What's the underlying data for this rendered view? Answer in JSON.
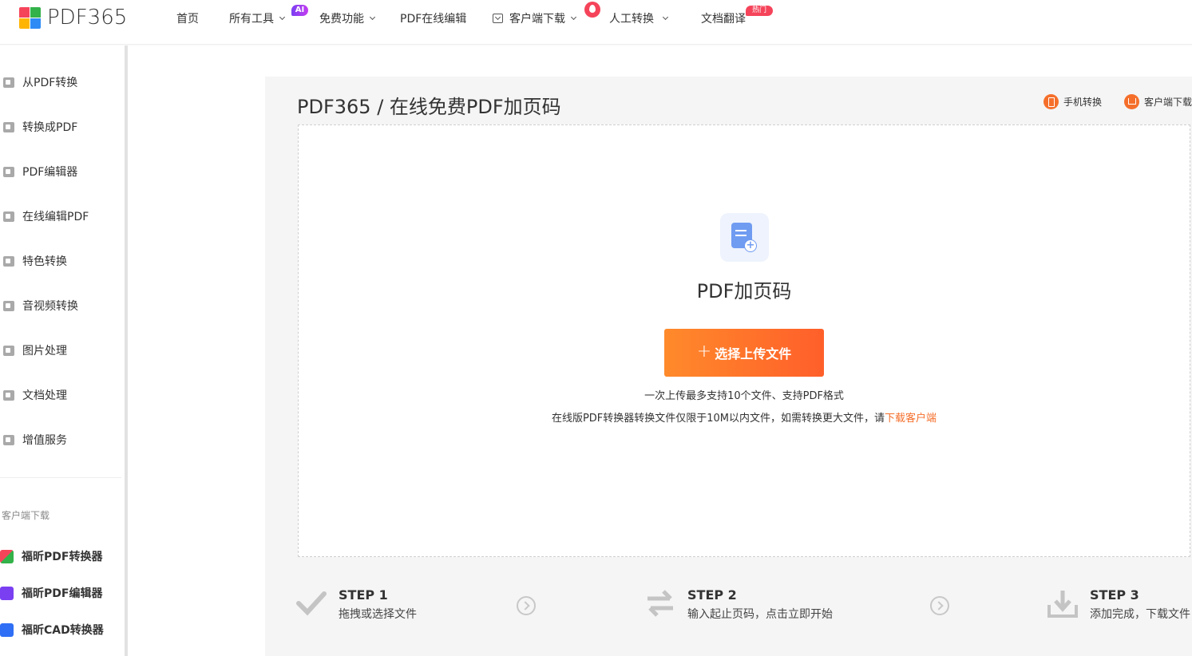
{
  "brand": {
    "name": "PDF365",
    "logo_colors": [
      "#f5445a",
      "#33b249",
      "#ffb400",
      "#2e8bf5"
    ]
  },
  "nav": {
    "home": "首页",
    "all_tools": "所有工具",
    "ai_badge": "AI",
    "free_features": "免费功能",
    "pdf_online_edit": "PDF在线编辑",
    "client_download": "客户端下载",
    "manual_convert": "人工转换",
    "doc_translate": "文档翻译",
    "hot_badge": "热门"
  },
  "sidebar": {
    "items": [
      {
        "label": "从PDF转换",
        "icon": "pdf-convert-from-icon"
      },
      {
        "label": "转换成PDF",
        "icon": "convert-to-pdf-icon"
      },
      {
        "label": "PDF编辑器",
        "icon": "pdf-editor-icon"
      },
      {
        "label": "在线编辑PDF",
        "icon": "online-edit-icon"
      },
      {
        "label": "特色转换",
        "icon": "star-badge-icon"
      },
      {
        "label": "音视频转换",
        "icon": "media-icon"
      },
      {
        "label": "图片处理",
        "icon": "image-icon"
      },
      {
        "label": "文档处理",
        "icon": "document-icon"
      },
      {
        "label": "增值服务",
        "icon": "list-icon"
      }
    ],
    "client_caption": "客户端下载",
    "apps": [
      {
        "label": "福昕PDF转换器",
        "icon": "foxit-converter-icon"
      },
      {
        "label": "福昕PDF编辑器",
        "icon": "foxit-editor-icon"
      },
      {
        "label": "福昕CAD转换器",
        "icon": "foxit-cad-icon"
      }
    ]
  },
  "main": {
    "breadcrumb": "PDF365 / 在线免费PDF加页码",
    "mobile_link": "手机转换",
    "client_link": "客户端下载",
    "tool_title": "PDF加页码",
    "upload_button": "选择上传文件",
    "upload_plus": "+",
    "note_line1": "一次上传最多支持10个文件、支持PDF格式",
    "note_line2_prefix": "在线版PDF转换器转换文件仅限于10M以内文件，如需转换更大文件，请",
    "note_line2_link": "下载客户端",
    "accent_color": "#f56f2b"
  },
  "steps": [
    {
      "title": "STEP 1",
      "desc": "拖拽或选择文件",
      "icon": "checkmark-icon"
    },
    {
      "title": "STEP 2",
      "desc": "输入起止页码，点击立即开始",
      "icon": "swap-arrows-icon"
    },
    {
      "title": "STEP 3",
      "desc": "添加完成，下载文件",
      "icon": "download-tray-icon"
    }
  ]
}
